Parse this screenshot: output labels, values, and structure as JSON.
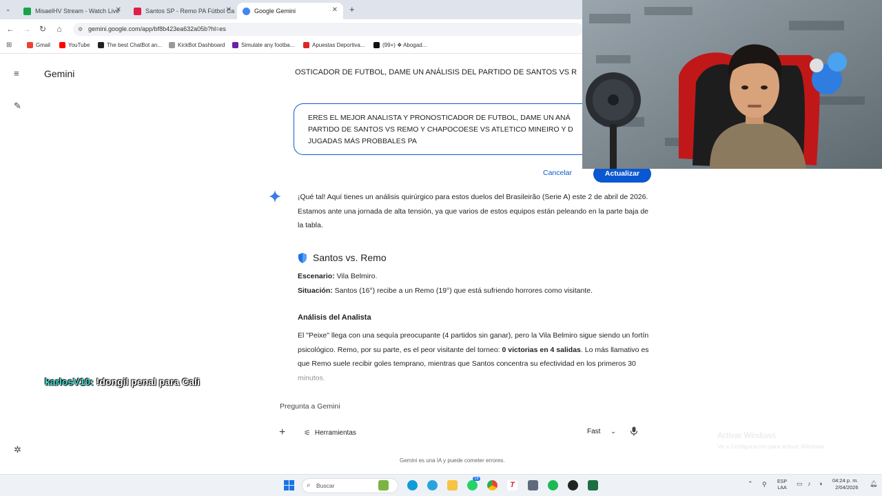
{
  "browser": {
    "tabs": [
      {
        "title": "MisaelHV Stream - Watch Live",
        "favicon_color": "#16a34a"
      },
      {
        "title": "Santos SP - Remo PA Fútbol Ca",
        "favicon_color": "#e11d48"
      },
      {
        "title": "Google Gemini",
        "favicon_color": "#4285f4"
      }
    ],
    "url": "gemini.google.com/app/bf8b423ea632a05b?hl=es",
    "bookmarks": [
      {
        "label": "Gmail",
        "color": "#ea4335"
      },
      {
        "label": "YouTube",
        "color": "#ff0000"
      },
      {
        "label": "The best ChatBot an...",
        "color": "#222222"
      },
      {
        "label": "KickBot Dashboard",
        "color": "#999999"
      },
      {
        "label": "Simulate any footba...",
        "color": "#6b21a8"
      },
      {
        "label": "Apuestas Deportiva...",
        "color": "#dc2626"
      },
      {
        "label": "(99+) ❖ Abogad...",
        "color": "#111111"
      }
    ]
  },
  "gemini": {
    "app_title": "Gemini",
    "prompt_header": "OSTICADOR DE FUTBOL, DAME UN ANÁLISIS DEL PARTIDO DE SANTOS VS R",
    "edit_lines": [
      "ERES EL MEJOR ANALISTA Y PRONOSTICADOR DE FUTBOL, DAME UN ANÁ",
      "PARTIDO DE SANTOS VS REMO Y CHAPOCOESE VS ATLETICO MINEIRO Y D",
      "JUGADAS MÁS PROBBALES PA"
    ],
    "cancel_label": "Cancelar",
    "update_label": "Actualizar",
    "intro": "¡Qué tal! Aquí tienes un análisis quirúrgico para estos duelos del Brasileirão (Serie A) este 2 de abril de 2026. Estamos ante una jornada de alta tensión, ya que varios de estos equipos están peleando en la parte baja de la tabla.",
    "section_title": "Santos vs. Remo",
    "escenario_label": "Escenario:",
    "escenario_value": " Vila Belmiro.",
    "situacion_label": "Situación:",
    "situacion_value": " Santos (16°) recibe a un Remo (19°) que está sufriendo horrores como visitante.",
    "analysis_heading": "Análisis del Analista",
    "analysis_part1": "El \"Peixe\" llega con una sequía preocupante (4 partidos sin ganar), pero la Vila Belmiro sigue siendo un fortín psicológico. Remo, por su parte, es el peor visitante del torneo: ",
    "analysis_bold": "0 victorias en 4 salidas",
    "analysis_part2": ". Lo más llamativo es que Remo suele recibir goles temprano, mientras que Santos concentra su efectividad en los primeros 30 minutos.",
    "input_placeholder": "Pregunta a Gemini",
    "tools_label": "Herramientas",
    "model_label": "Fast",
    "disclaimer": "Gemini es una IA y puede cometer errores."
  },
  "chat_overlay": {
    "user": "karlosV10:",
    "message": " !dongil penal para Cali"
  },
  "windows": {
    "activate_title": "Activar Windows",
    "activate_sub": "Ve a Configuración para activar Windows.",
    "search_placeholder": "Buscar",
    "lang_top": "ESP",
    "lang_bottom": "LAA",
    "time": "04:24 p. m.",
    "date": "2/04/2026",
    "badge_count": "16"
  },
  "colors": {
    "accent": "#0b57d0",
    "tab_strip": "#dfe3eb"
  }
}
